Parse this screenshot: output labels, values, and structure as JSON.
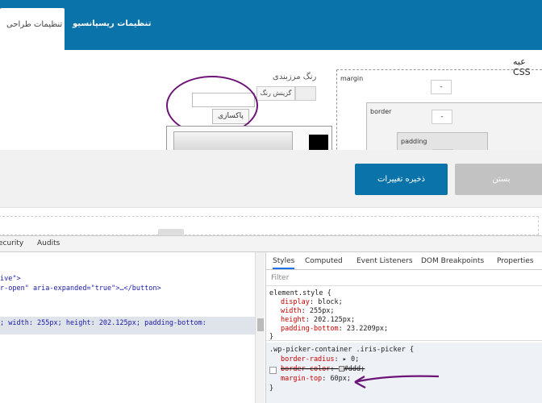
{
  "tabs": {
    "active_label": "تنظیمات طراحی",
    "other_label": "تنظیمات ریسپانسیو"
  },
  "settings": {
    "css_label": "عبه CSS",
    "margin_label": "margin",
    "border_label": "border",
    "padding_label": "padding",
    "margin_value": "-",
    "border_value": "-",
    "padding_value": "-",
    "border_color_label": "رنگ مرزبندی",
    "pick_color_label": "گزینش رنگ",
    "clear_label": "پاکسازی",
    "hex_value": ""
  },
  "actions": {
    "save_label": "ذخیره تغییرات",
    "close_label": "بستن"
  },
  "devtools": {
    "tabs": [
      "ecurity",
      "Audits"
    ],
    "code_lines": [
      "ive\">",
      "r-open\" aria-expanded=\"true\">…</button>",
      "; width: 255px; height: 202.125px; padding-bottom:"
    ],
    "styles_tabs": [
      "Styles",
      "Computed",
      "Event Listeners",
      "DOM Breakpoints",
      "Properties"
    ],
    "filter_placeholder": "Filter",
    "rule1": {
      "selector": "element.style {",
      "props": [
        {
          "name": "display",
          "value": "block;"
        },
        {
          "name": "width",
          "value": "255px;"
        },
        {
          "name": "height",
          "value": "202.125px;"
        },
        {
          "name": "padding-bottom",
          "value": "23.2209px;"
        }
      ],
      "close": "}"
    },
    "rule2": {
      "selector": ".wp-picker-container .iris-picker {",
      "props": [
        {
          "name": "border-radius",
          "value": "▸ 0;"
        },
        {
          "name": "border-color",
          "value": "#ddd;"
        },
        {
          "name": "margin-top",
          "value": "60px;"
        }
      ],
      "close": "}"
    },
    "annotation_color": "#6b1476"
  }
}
